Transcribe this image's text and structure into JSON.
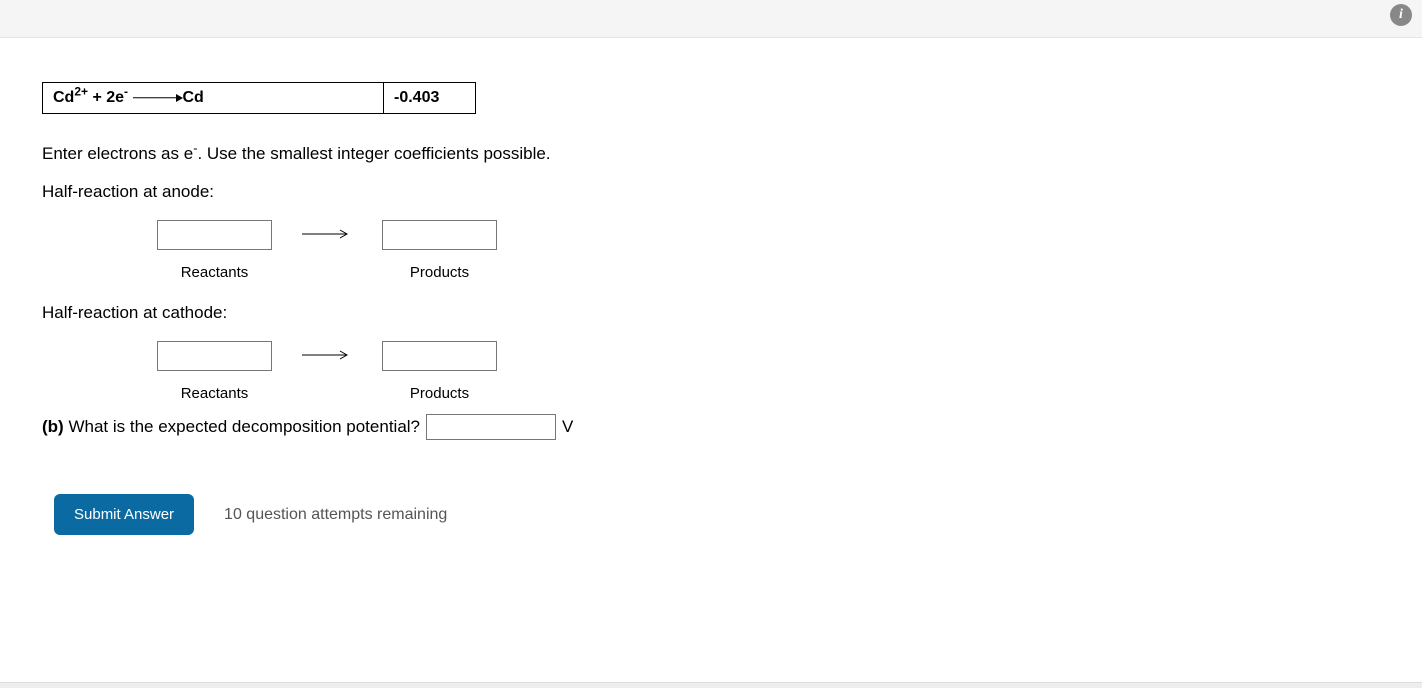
{
  "table": {
    "equation_html": "Cd<sup>2+</sup> + 2e<sup>-</sup>",
    "equation_product": "Cd",
    "potential": "-0.403"
  },
  "instruction_html": "Enter electrons as e<sup>-</sup>. Use the smallest integer coefficients possible.",
  "anode": {
    "title": "Half-reaction at anode:",
    "reactants_label": "Reactants",
    "products_label": "Products"
  },
  "cathode": {
    "title": "Half-reaction at cathode:",
    "reactants_label": "Reactants",
    "products_label": "Products"
  },
  "partB": {
    "label_prefix": "(b)",
    "question": "What is the expected decomposition potential?",
    "unit": "V"
  },
  "submit": {
    "label": "Submit Answer",
    "attempts": "10 question attempts remaining"
  }
}
